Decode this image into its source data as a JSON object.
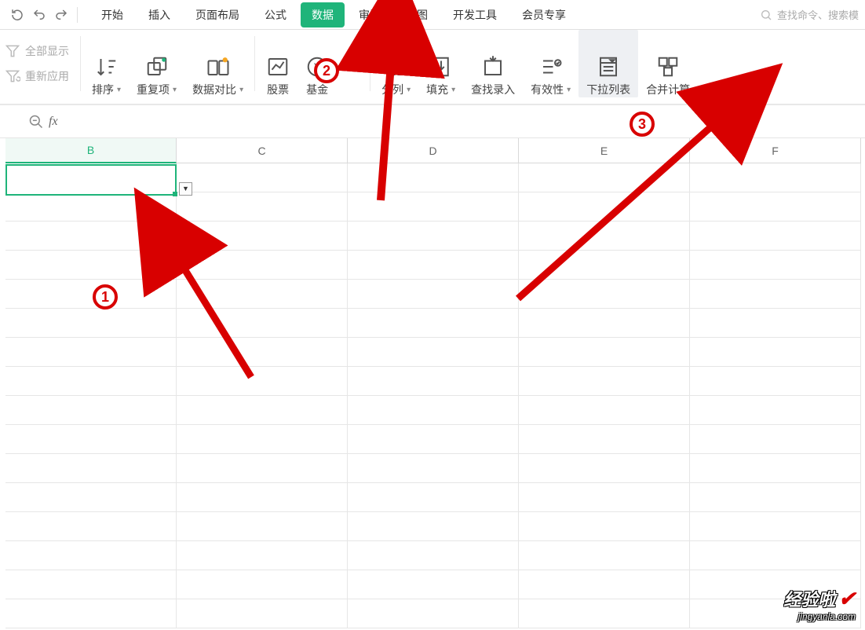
{
  "menu": {
    "tabs": [
      "开始",
      "插入",
      "页面布局",
      "公式",
      "数据",
      "审阅",
      "视图",
      "开发工具",
      "会员专享"
    ],
    "active_index": 4,
    "search_placeholder": "查找命令、搜索模"
  },
  "quick": {
    "show_all": "全部显示",
    "reapply": "重新应用"
  },
  "ribbon": {
    "sort": "排序",
    "dup": "重复项",
    "compare": "数据对比",
    "stock": "股票",
    "fund": "基金",
    "split": "分列",
    "fill": "填充",
    "findentry": "查找录入",
    "validate": "有效性",
    "dropdown": "下拉列表",
    "consolidate": "合并计算"
  },
  "columns": [
    "B",
    "C",
    "D",
    "E",
    "F"
  ],
  "active_column_index": 0,
  "annotations": {
    "b1": "1",
    "b2": "2",
    "b3": "3"
  },
  "watermark": {
    "title": "经验啦",
    "url": "jingyanla.com"
  }
}
